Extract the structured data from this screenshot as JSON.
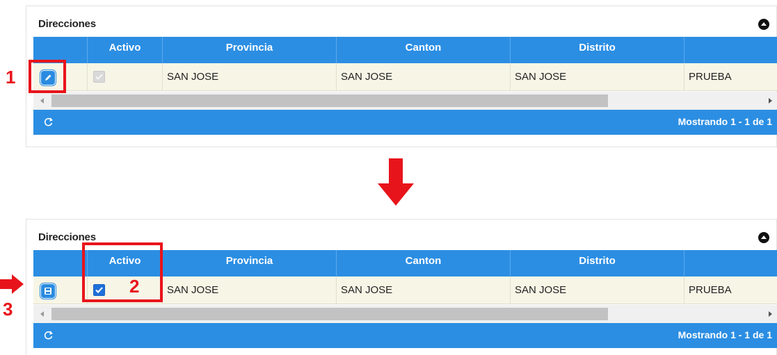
{
  "panel": {
    "title": "Direcciones",
    "columns": [
      "",
      "Activo",
      "Provincia",
      "Canton",
      "Distrito",
      ""
    ],
    "row": {
      "provincia": "SAN JOSE",
      "canton": "SAN JOSE",
      "distrito": "SAN JOSE",
      "extra": "PRUEBA"
    },
    "pager": "Mostrando 1 - 1 de 1"
  },
  "callouts": {
    "one": "1",
    "two": "2",
    "three": "3"
  },
  "colors": {
    "header_blue": "#2b8ee3",
    "row_bg": "#f7f5e6",
    "annotation_red": "#e8141b"
  },
  "icons": {
    "edit": "pencil-icon",
    "save": "save-icon",
    "refresh": "refresh-icon",
    "collapse": "collapse-icon"
  }
}
